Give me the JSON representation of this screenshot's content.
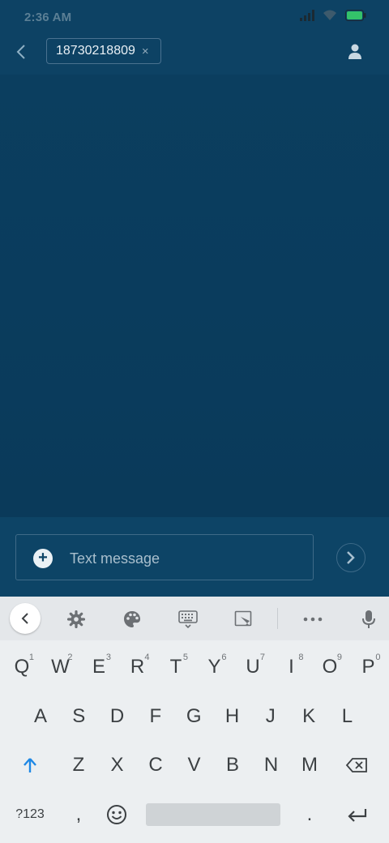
{
  "status_bar": {
    "time": "2:36 AM",
    "battery_color": "#34c26a"
  },
  "header": {
    "recipient": "18730218809",
    "remove_glyph": "×"
  },
  "compose": {
    "placeholder": "Text message",
    "attach_glyph": "+"
  },
  "keyboard": {
    "row1": [
      {
        "key": "Q",
        "hint": "1"
      },
      {
        "key": "W",
        "hint": "2"
      },
      {
        "key": "E",
        "hint": "3"
      },
      {
        "key": "R",
        "hint": "4"
      },
      {
        "key": "T",
        "hint": "5"
      },
      {
        "key": "Y",
        "hint": "6"
      },
      {
        "key": "U",
        "hint": "7"
      },
      {
        "key": "I",
        "hint": "8"
      },
      {
        "key": "O",
        "hint": "9"
      },
      {
        "key": "P",
        "hint": "0"
      }
    ],
    "row2": [
      "A",
      "S",
      "D",
      "F",
      "G",
      "H",
      "J",
      "K",
      "L"
    ],
    "row3": [
      "Z",
      "X",
      "C",
      "V",
      "B",
      "N",
      "M"
    ],
    "bottom": {
      "symbols": "?123",
      "comma": ",",
      "period": "."
    }
  },
  "colors": {
    "accent": "#1e88e5",
    "background": "#0b3f60",
    "keyboard_bg": "#eceff1"
  }
}
